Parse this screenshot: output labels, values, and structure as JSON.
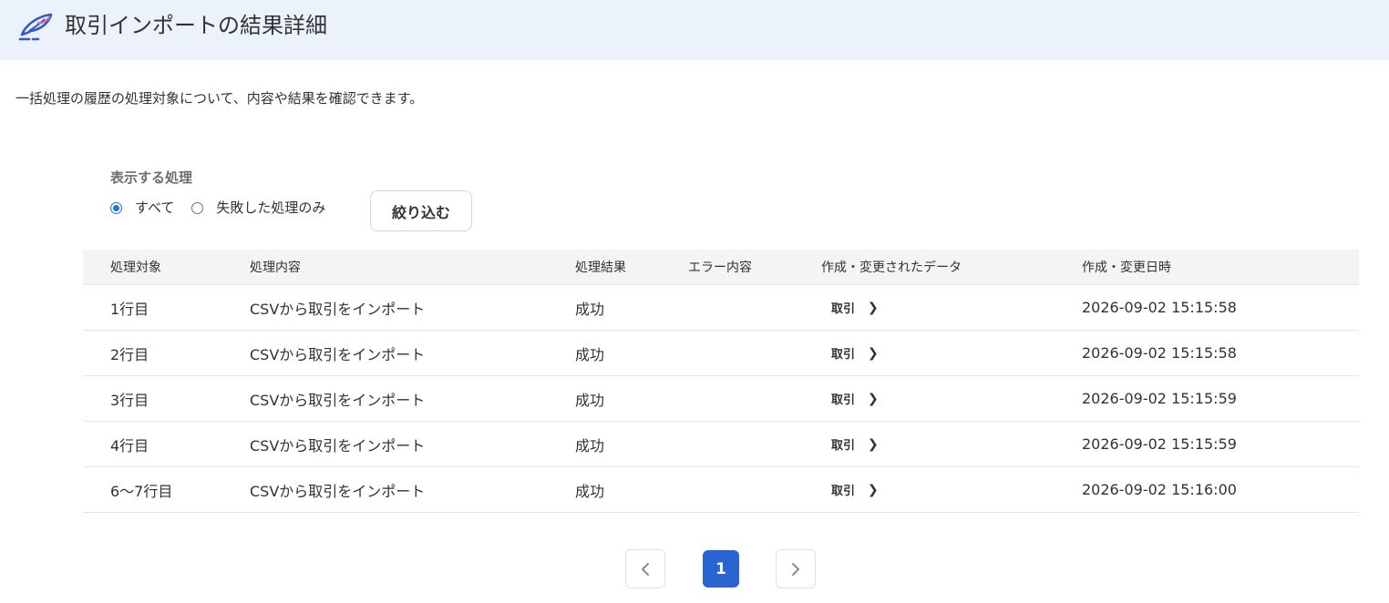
{
  "header": {
    "title": "取引インポートの結果詳細",
    "icon": "feather-pen-icon"
  },
  "description": "一括処理の履歴の処理対象について、内容や結果を確認できます。",
  "filter": {
    "label": "表示する処理",
    "options": [
      {
        "label": "すべて",
        "checked": true
      },
      {
        "label": "失敗した処理のみ",
        "checked": false
      }
    ],
    "button_label": "絞り込む"
  },
  "table": {
    "columns": [
      "処理対象",
      "処理内容",
      "処理結果",
      "エラー内容",
      "作成・変更されたデータ",
      "作成・変更日時"
    ],
    "rows": [
      {
        "target": "1行目",
        "content": "CSVから取引をインポート",
        "result": "成功",
        "error": "",
        "data_link": "取引",
        "datetime": "2026-09-02 15:15:58"
      },
      {
        "target": "2行目",
        "content": "CSVから取引をインポート",
        "result": "成功",
        "error": "",
        "data_link": "取引",
        "datetime": "2026-09-02 15:15:58"
      },
      {
        "target": "3行目",
        "content": "CSVから取引をインポート",
        "result": "成功",
        "error": "",
        "data_link": "取引",
        "datetime": "2026-09-02 15:15:59"
      },
      {
        "target": "4行目",
        "content": "CSVから取引をインポート",
        "result": "成功",
        "error": "",
        "data_link": "取引",
        "datetime": "2026-09-02 15:15:59"
      },
      {
        "target": "6〜7行目",
        "content": "CSVから取引をインポート",
        "result": "成功",
        "error": "",
        "data_link": "取引",
        "datetime": "2026-09-02 15:16:00"
      }
    ]
  },
  "pagination": {
    "current_page": "1",
    "prev_icon": "chevron-left-icon",
    "next_icon": "chevron-right-icon"
  },
  "colors": {
    "header_bg": "#ebf2fc",
    "accent": "#2864d2",
    "radio_selected": "#1a73e8",
    "table_header_bg": "#f5f3f3"
  }
}
